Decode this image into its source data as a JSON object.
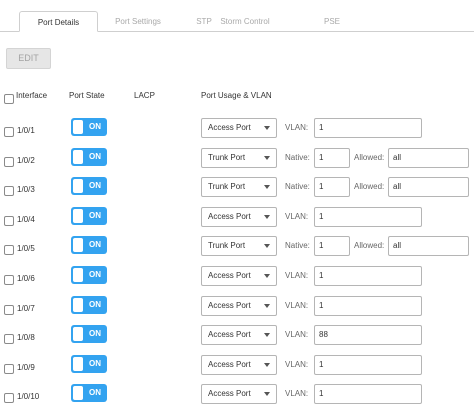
{
  "tabs": [
    {
      "label": "Port Details",
      "active": true
    },
    {
      "label": "Port Settings",
      "active": false
    },
    {
      "label": "STP",
      "active": false
    },
    {
      "label": "Storm Control",
      "active": false
    },
    {
      "label": "PSE",
      "active": false
    }
  ],
  "toolbar": {
    "edit_label": "EDIT"
  },
  "headers": {
    "interface": "Interface",
    "port_state": "Port State",
    "lacp": "LACP",
    "port_usage": "Port Usage & VLAN"
  },
  "toggle_label": "ON",
  "labels": {
    "vlan": "VLAN:",
    "native": "Native:",
    "allowed": "Allowed:"
  },
  "colors": {
    "toggle_on": "#33a3f0",
    "tab_inactive": "#a9a9a9"
  },
  "rows": [
    {
      "interface": "1/0/1",
      "mode": "Access Port",
      "vlan": "1"
    },
    {
      "interface": "1/0/2",
      "mode": "Trunk Port",
      "native": "1",
      "allowed": "all"
    },
    {
      "interface": "1/0/3",
      "mode": "Trunk Port",
      "native": "1",
      "allowed": "all"
    },
    {
      "interface": "1/0/4",
      "mode": "Access Port",
      "vlan": "1"
    },
    {
      "interface": "1/0/5",
      "mode": "Trunk Port",
      "native": "1",
      "allowed": "all"
    },
    {
      "interface": "1/0/6",
      "mode": "Access Port",
      "vlan": "1"
    },
    {
      "interface": "1/0/7",
      "mode": "Access Port",
      "vlan": "1"
    },
    {
      "interface": "1/0/8",
      "mode": "Access Port",
      "vlan": "88"
    },
    {
      "interface": "1/0/9",
      "mode": "Access Port",
      "vlan": "1"
    },
    {
      "interface": "1/0/10",
      "mode": "Access Port",
      "vlan": "1"
    }
  ]
}
